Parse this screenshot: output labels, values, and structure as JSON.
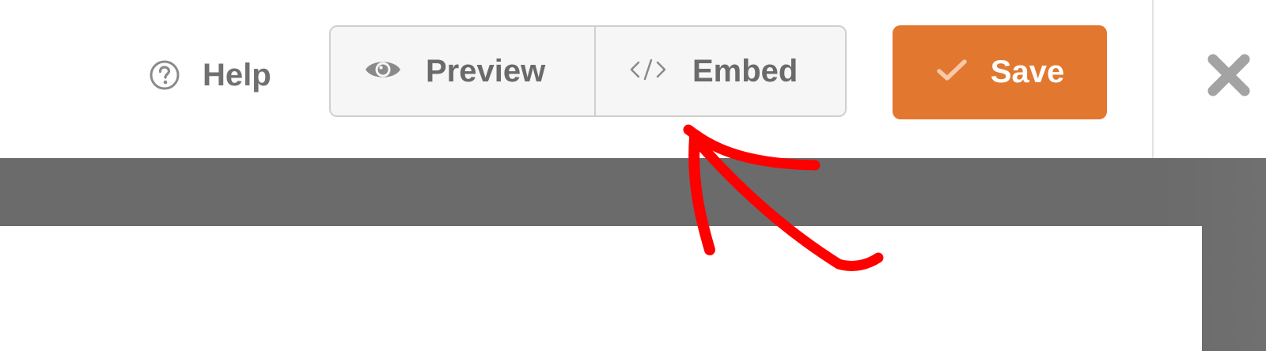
{
  "toolbar": {
    "help_label": "Help",
    "preview_label": "Preview",
    "embed_label": "Embed",
    "save_label": "Save"
  },
  "icons": {
    "help": "question-circle-icon",
    "preview": "eye-icon",
    "embed": "code-icon",
    "save": "check-icon",
    "close": "close-icon"
  },
  "colors": {
    "save_button": "#e27730",
    "text_gray": "#707070",
    "canvas_gray": "#6b6b6b",
    "annotation_red": "#ff0000"
  }
}
